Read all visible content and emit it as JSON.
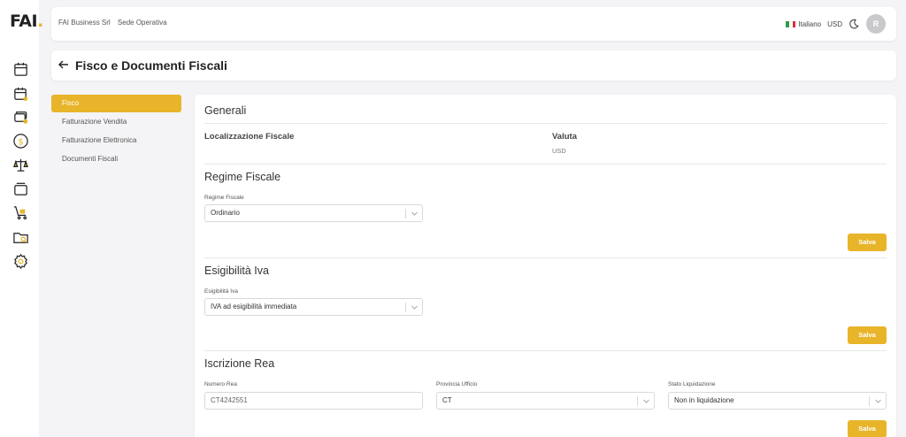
{
  "logo": {
    "text": "FAI",
    "dot": "."
  },
  "colors": {
    "accent": "#e8b42a",
    "background": "#f4f4f6"
  },
  "rail": {
    "icons": [
      "calendar-icon",
      "calendar-user-icon",
      "cards-icon",
      "dollar-icon",
      "scale-icon",
      "layers-icon",
      "cart-icon",
      "folder-search-icon",
      "gear-icon"
    ]
  },
  "topbar": {
    "company": "FAI Business Srl",
    "site": "Sede Operativa",
    "language": "Italiano",
    "currency": "USD",
    "avatar_initial": "R"
  },
  "page": {
    "title": "Fisco e Documenti Fiscali"
  },
  "nav": {
    "items": [
      {
        "label": "Fisco",
        "active": true
      },
      {
        "label": "Fatturazione Vendita",
        "active": false
      },
      {
        "label": "Fatturazione Elettronica",
        "active": false
      },
      {
        "label": "Documenti Fiscali",
        "active": false
      }
    ]
  },
  "sections": {
    "generali": {
      "title": "Generali",
      "localizzazione_label": "Localizzazione Fiscale",
      "valuta_label": "Valuta",
      "valuta_value": "USD"
    },
    "regime": {
      "title": "Regime Fiscale",
      "field_label": "Regime Fiscale",
      "field_value": "Ordinario",
      "save_label": "Salva"
    },
    "esigibilita": {
      "title": "Esigibilità Iva",
      "field_label": "Esigibilità Iva",
      "field_value": "IVA ad esigibilità immediata",
      "save_label": "Salva"
    },
    "rea": {
      "title": "Iscrizione Rea",
      "numero_label": "Numero Rea",
      "numero_value": "CT4242551",
      "provincia_label": "Provincia Ufficio",
      "provincia_value": "CT",
      "stato_label": "Stato Liquidazione",
      "stato_value": "Non in liquidazione",
      "save_label": "Salva"
    }
  }
}
